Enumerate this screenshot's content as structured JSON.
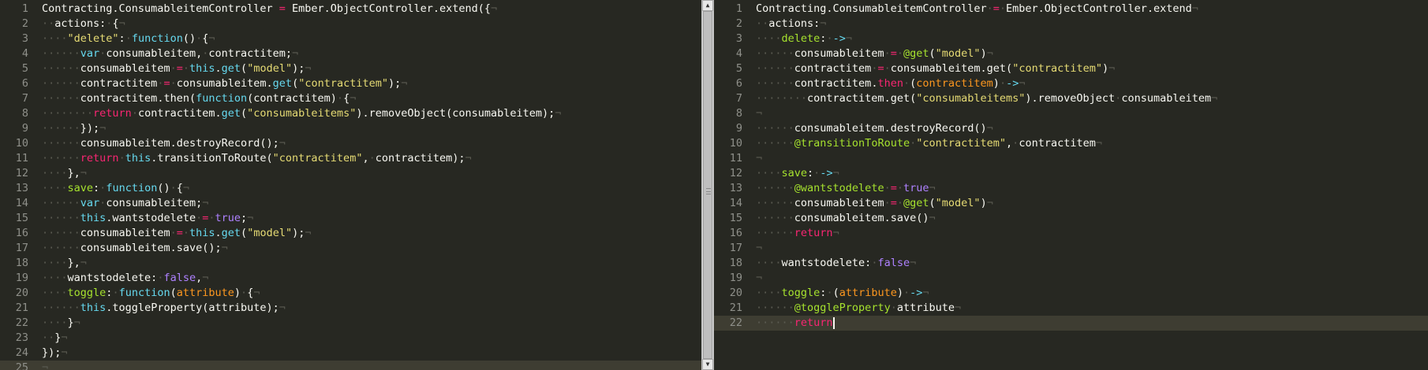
{
  "colors": {
    "background": "#272822",
    "text": "#f8f8f2",
    "keyword": "#66d9ef",
    "string": "#e6db74",
    "operator": "#f92672",
    "boolean": "#ae81ff",
    "attribute": "#a6e22e",
    "argument": "#fd971f",
    "whitespace_marker": "#5b5b52",
    "line_number": "#8f908a"
  },
  "left_editor": {
    "lines": [
      [
        [
          "Contracting.ConsumableitemController",
          "plain"
        ],
        [
          " ",
          "ws"
        ],
        [
          "=",
          "op"
        ],
        [
          " ",
          "ws"
        ],
        [
          "Ember.ObjectController.extend({",
          "plain"
        ],
        [
          "¬",
          "ws"
        ]
      ],
      [
        [
          "··",
          "ws"
        ],
        [
          "actions:",
          "plain"
        ],
        [
          "·",
          "ws"
        ],
        [
          "{",
          "plain"
        ],
        [
          "¬",
          "ws"
        ]
      ],
      [
        [
          "····",
          "ws"
        ],
        [
          "\"delete\"",
          "str"
        ],
        [
          ":",
          "plain"
        ],
        [
          "·",
          "ws"
        ],
        [
          "function",
          "kw"
        ],
        [
          "()",
          "plain"
        ],
        [
          "·",
          "ws"
        ],
        [
          "{",
          "plain"
        ],
        [
          "¬",
          "ws"
        ]
      ],
      [
        [
          "······",
          "ws"
        ],
        [
          "var",
          "kw"
        ],
        [
          "·",
          "ws"
        ],
        [
          "consumableitem,",
          "plain"
        ],
        [
          "·",
          "ws"
        ],
        [
          "contractitem;",
          "plain"
        ],
        [
          "¬",
          "ws"
        ]
      ],
      [
        [
          "······",
          "ws"
        ],
        [
          "consumableitem",
          "plain"
        ],
        [
          "·",
          "ws"
        ],
        [
          "=",
          "op"
        ],
        [
          "·",
          "ws"
        ],
        [
          "this",
          "kw"
        ],
        [
          ".",
          "plain"
        ],
        [
          "get",
          "call"
        ],
        [
          "(",
          "plain"
        ],
        [
          "\"model\"",
          "str"
        ],
        [
          ");",
          "plain"
        ],
        [
          "¬",
          "ws"
        ]
      ],
      [
        [
          "······",
          "ws"
        ],
        [
          "contractitem",
          "plain"
        ],
        [
          "·",
          "ws"
        ],
        [
          "=",
          "op"
        ],
        [
          "·",
          "ws"
        ],
        [
          "consumableitem.",
          "plain"
        ],
        [
          "get",
          "call"
        ],
        [
          "(",
          "plain"
        ],
        [
          "\"contractitem\"",
          "str"
        ],
        [
          ");",
          "plain"
        ],
        [
          "¬",
          "ws"
        ]
      ],
      [
        [
          "······",
          "ws"
        ],
        [
          "contractitem.then(",
          "plain"
        ],
        [
          "function",
          "kw"
        ],
        [
          "(contractitem)",
          "plain"
        ],
        [
          "·",
          "ws"
        ],
        [
          "{",
          "plain"
        ],
        [
          "¬",
          "ws"
        ]
      ],
      [
        [
          "········",
          "ws"
        ],
        [
          "return",
          "op"
        ],
        [
          "·",
          "ws"
        ],
        [
          "contractitem.",
          "plain"
        ],
        [
          "get",
          "call"
        ],
        [
          "(",
          "plain"
        ],
        [
          "\"consumableitems\"",
          "str"
        ],
        [
          ").removeObject(consumableitem);",
          "plain"
        ],
        [
          "¬",
          "ws"
        ]
      ],
      [
        [
          "······",
          "ws"
        ],
        [
          "});",
          "plain"
        ],
        [
          "¬",
          "ws"
        ]
      ],
      [
        [
          "······",
          "ws"
        ],
        [
          "consumableitem.destroyRecord();",
          "plain"
        ],
        [
          "¬",
          "ws"
        ]
      ],
      [
        [
          "······",
          "ws"
        ],
        [
          "return",
          "op"
        ],
        [
          "·",
          "ws"
        ],
        [
          "this",
          "kw"
        ],
        [
          ".transitionToRoute(",
          "plain"
        ],
        [
          "\"contractitem\"",
          "str"
        ],
        [
          ",",
          "plain"
        ],
        [
          "·",
          "ws"
        ],
        [
          "contractitem);",
          "plain"
        ],
        [
          "¬",
          "ws"
        ]
      ],
      [
        [
          "····",
          "ws"
        ],
        [
          "},",
          "plain"
        ],
        [
          "¬",
          "ws"
        ]
      ],
      [
        [
          "····",
          "ws"
        ],
        [
          "save",
          "at"
        ],
        [
          ":",
          "plain"
        ],
        [
          "·",
          "ws"
        ],
        [
          "function",
          "kw"
        ],
        [
          "()",
          "plain"
        ],
        [
          "·",
          "ws"
        ],
        [
          "{",
          "plain"
        ],
        [
          "¬",
          "ws"
        ]
      ],
      [
        [
          "······",
          "ws"
        ],
        [
          "var",
          "kw"
        ],
        [
          "·",
          "ws"
        ],
        [
          "consumableitem;",
          "plain"
        ],
        [
          "¬",
          "ws"
        ]
      ],
      [
        [
          "······",
          "ws"
        ],
        [
          "this",
          "kw"
        ],
        [
          ".wantstodelete",
          "plain"
        ],
        [
          "·",
          "ws"
        ],
        [
          "=",
          "op"
        ],
        [
          "·",
          "ws"
        ],
        [
          "true",
          "bi"
        ],
        [
          ";",
          "plain"
        ],
        [
          "¬",
          "ws"
        ]
      ],
      [
        [
          "······",
          "ws"
        ],
        [
          "consumableitem",
          "plain"
        ],
        [
          "·",
          "ws"
        ],
        [
          "=",
          "op"
        ],
        [
          "·",
          "ws"
        ],
        [
          "this",
          "kw"
        ],
        [
          ".",
          "plain"
        ],
        [
          "get",
          "call"
        ],
        [
          "(",
          "plain"
        ],
        [
          "\"model\"",
          "str"
        ],
        [
          ");",
          "plain"
        ],
        [
          "¬",
          "ws"
        ]
      ],
      [
        [
          "······",
          "ws"
        ],
        [
          "consumableitem.save();",
          "plain"
        ],
        [
          "¬",
          "ws"
        ]
      ],
      [
        [
          "····",
          "ws"
        ],
        [
          "},",
          "plain"
        ],
        [
          "¬",
          "ws"
        ]
      ],
      [
        [
          "····",
          "ws"
        ],
        [
          "wantstodelete:",
          "plain"
        ],
        [
          "·",
          "ws"
        ],
        [
          "false",
          "bi"
        ],
        [
          ",",
          "plain"
        ],
        [
          "¬",
          "ws"
        ]
      ],
      [
        [
          "····",
          "ws"
        ],
        [
          "toggle",
          "at"
        ],
        [
          ":",
          "plain"
        ],
        [
          "·",
          "ws"
        ],
        [
          "function",
          "kw"
        ],
        [
          "(",
          "plain"
        ],
        [
          "attribute",
          "arg"
        ],
        [
          ")",
          "plain"
        ],
        [
          "·",
          "ws"
        ],
        [
          "{",
          "plain"
        ],
        [
          "¬",
          "ws"
        ]
      ],
      [
        [
          "······",
          "ws"
        ],
        [
          "this",
          "kw"
        ],
        [
          ".toggleProperty(attribute);",
          "plain"
        ],
        [
          "¬",
          "ws"
        ]
      ],
      [
        [
          "····",
          "ws"
        ],
        [
          "}",
          "plain"
        ],
        [
          "¬",
          "ws"
        ]
      ],
      [
        [
          "··",
          "ws"
        ],
        [
          "}",
          "plain"
        ],
        [
          "¬",
          "ws"
        ]
      ],
      [
        [
          "});",
          "plain"
        ],
        [
          "¬",
          "ws"
        ]
      ],
      [
        [
          "¬",
          "ws"
        ]
      ]
    ]
  },
  "right_editor": {
    "lines": [
      [
        [
          "Contracting.ConsumableitemController",
          "plain"
        ],
        [
          "·",
          "ws"
        ],
        [
          "=",
          "op"
        ],
        [
          "·",
          "ws"
        ],
        [
          "Ember.ObjectController.extend",
          "plain"
        ],
        [
          "¬",
          "ws"
        ]
      ],
      [
        [
          "··",
          "ws"
        ],
        [
          "actions:",
          "plain"
        ],
        [
          "¬",
          "ws"
        ]
      ],
      [
        [
          "····",
          "ws"
        ],
        [
          "delete",
          "at"
        ],
        [
          ":",
          "plain"
        ],
        [
          "·",
          "ws"
        ],
        [
          "->",
          "kw"
        ],
        [
          "¬",
          "ws"
        ]
      ],
      [
        [
          "······",
          "ws"
        ],
        [
          "consumableitem",
          "plain"
        ],
        [
          "·",
          "ws"
        ],
        [
          "=",
          "op"
        ],
        [
          "·",
          "ws"
        ],
        [
          "@get",
          "at"
        ],
        [
          "(",
          "plain"
        ],
        [
          "\"model\"",
          "str"
        ],
        [
          ")",
          "plain"
        ],
        [
          "¬",
          "ws"
        ]
      ],
      [
        [
          "······",
          "ws"
        ],
        [
          "contractitem",
          "plain"
        ],
        [
          "·",
          "ws"
        ],
        [
          "=",
          "op"
        ],
        [
          "·",
          "ws"
        ],
        [
          "consumableitem.get(",
          "plain"
        ],
        [
          "\"contractitem\"",
          "str"
        ],
        [
          ")",
          "plain"
        ],
        [
          "¬",
          "ws"
        ]
      ],
      [
        [
          "······",
          "ws"
        ],
        [
          "contractitem.",
          "plain"
        ],
        [
          "then",
          "op"
        ],
        [
          "·",
          "ws"
        ],
        [
          "(",
          "plain"
        ],
        [
          "contractitem",
          "arg"
        ],
        [
          ")",
          "plain"
        ],
        [
          "·",
          "ws"
        ],
        [
          "->",
          "kw"
        ],
        [
          "¬",
          "ws"
        ]
      ],
      [
        [
          "········",
          "ws"
        ],
        [
          "contractitem.get(",
          "plain"
        ],
        [
          "\"consumableitems\"",
          "str"
        ],
        [
          ").removeObject",
          "plain"
        ],
        [
          "·",
          "ws"
        ],
        [
          "consumableitem",
          "plain"
        ],
        [
          "¬",
          "ws"
        ]
      ],
      [
        [
          "¬",
          "ws"
        ]
      ],
      [
        [
          "······",
          "ws"
        ],
        [
          "consumableitem.destroyRecord()",
          "plain"
        ],
        [
          "¬",
          "ws"
        ]
      ],
      [
        [
          "······",
          "ws"
        ],
        [
          "@transitionToRoute",
          "at"
        ],
        [
          "·",
          "ws"
        ],
        [
          "\"contractitem\"",
          "str"
        ],
        [
          ",",
          "plain"
        ],
        [
          "·",
          "ws"
        ],
        [
          "contractitem",
          "plain"
        ],
        [
          "¬",
          "ws"
        ]
      ],
      [
        [
          "¬",
          "ws"
        ]
      ],
      [
        [
          "····",
          "ws"
        ],
        [
          "save",
          "at"
        ],
        [
          ":",
          "plain"
        ],
        [
          "·",
          "ws"
        ],
        [
          "->",
          "kw"
        ],
        [
          "¬",
          "ws"
        ]
      ],
      [
        [
          "······",
          "ws"
        ],
        [
          "@wantstodelete",
          "at"
        ],
        [
          "·",
          "ws"
        ],
        [
          "=",
          "op"
        ],
        [
          "·",
          "ws"
        ],
        [
          "true",
          "bi"
        ],
        [
          "¬",
          "ws"
        ]
      ],
      [
        [
          "······",
          "ws"
        ],
        [
          "consumableitem",
          "plain"
        ],
        [
          "·",
          "ws"
        ],
        [
          "=",
          "op"
        ],
        [
          "·",
          "ws"
        ],
        [
          "@get",
          "at"
        ],
        [
          "(",
          "plain"
        ],
        [
          "\"model\"",
          "str"
        ],
        [
          ")",
          "plain"
        ],
        [
          "¬",
          "ws"
        ]
      ],
      [
        [
          "······",
          "ws"
        ],
        [
          "consumableitem.save()",
          "plain"
        ],
        [
          "¬",
          "ws"
        ]
      ],
      [
        [
          "······",
          "ws"
        ],
        [
          "return",
          "op"
        ],
        [
          "¬",
          "ws"
        ]
      ],
      [
        [
          "¬",
          "ws"
        ]
      ],
      [
        [
          "····",
          "ws"
        ],
        [
          "wantstodelete:",
          "plain"
        ],
        [
          "·",
          "ws"
        ],
        [
          "false",
          "bi"
        ],
        [
          "¬",
          "ws"
        ]
      ],
      [
        [
          "¬",
          "ws"
        ]
      ],
      [
        [
          "····",
          "ws"
        ],
        [
          "toggle",
          "at"
        ],
        [
          ":",
          "plain"
        ],
        [
          "·",
          "ws"
        ],
        [
          "(",
          "plain"
        ],
        [
          "attribute",
          "arg"
        ],
        [
          ")",
          "plain"
        ],
        [
          "·",
          "ws"
        ],
        [
          "->",
          "kw"
        ],
        [
          "¬",
          "ws"
        ]
      ],
      [
        [
          "······",
          "ws"
        ],
        [
          "@toggleProperty",
          "at"
        ],
        [
          "·",
          "ws"
        ],
        [
          "attribute",
          "plain"
        ],
        [
          "¬",
          "ws"
        ]
      ],
      [
        [
          "······",
          "ws"
        ],
        [
          "return",
          "op"
        ]
      ]
    ]
  }
}
